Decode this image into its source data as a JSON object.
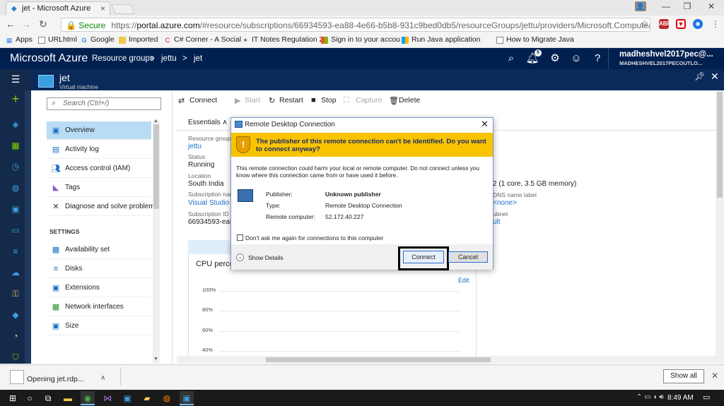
{
  "browser": {
    "tab_title": "jet - Microsoft Azure",
    "tab_close": "×",
    "window_controls": {
      "minimize": "—",
      "restore": "❐",
      "close": "✕"
    },
    "secure_label": "Secure",
    "url_scheme": "https://",
    "url_host": "portal.azure.com",
    "url_path": "/#resource/subscriptions/66934593-ea88-4e66-b5b8-931c9bed0db5/resourceGroups/jettu/providers/Microsoft.Compute/virtualMachines/jet/",
    "bookmarks": [
      {
        "label": "Apps",
        "icon": "apps-grid-icon"
      },
      {
        "label": "URLhtml",
        "icon": "page-icon"
      },
      {
        "label": "Google",
        "icon": "google-icon"
      },
      {
        "label": "Imported",
        "icon": "folder-icon"
      },
      {
        "label": "C# Corner - A Social",
        "icon": "csharp-icon"
      },
      {
        "label": "IT Notes Regulation 2",
        "icon": "it-notes-icon"
      },
      {
        "label": "Sign in to your accou",
        "icon": "microsoft-icon"
      },
      {
        "label": "Run Java application",
        "icon": "microsoft-icon"
      },
      {
        "label": "How to Migrate Java",
        "icon": "page-icon"
      }
    ]
  },
  "azure": {
    "logo": "Microsoft Azure",
    "breadcrumb": [
      "Resource groups",
      "jettu",
      "jet"
    ],
    "breadcrumb_sep": ">",
    "notification_count": "5",
    "user_name": "madheshvel2017pec@...",
    "user_tenant": "MADHESHVEL2017PECOUTLO..."
  },
  "blade": {
    "name": "jet",
    "subtitle": "Virtual machine"
  },
  "menu": {
    "search_placeholder": "Search (Ctrl+/)",
    "items": [
      {
        "label": "Overview",
        "icon": "overview-icon",
        "active": true
      },
      {
        "label": "Activity log",
        "icon": "activity-log-icon"
      },
      {
        "label": "Access control (IAM)",
        "icon": "iam-icon"
      },
      {
        "label": "Tags",
        "icon": "tag-icon"
      },
      {
        "label": "Diagnose and solve problems",
        "icon": "wrench-icon"
      }
    ],
    "settings_header": "SETTINGS",
    "settings_items": [
      {
        "label": "Availability set",
        "icon": "availability-set-icon"
      },
      {
        "label": "Disks",
        "icon": "disk-icon"
      },
      {
        "label": "Extensions",
        "icon": "extension-icon"
      },
      {
        "label": "Network interfaces",
        "icon": "network-icon"
      },
      {
        "label": "Size",
        "icon": "size-icon"
      }
    ]
  },
  "toolbar": {
    "connect": "Connect",
    "start": "Start",
    "restart": "Restart",
    "stop": "Stop",
    "capture": "Capture",
    "delete": "Delete"
  },
  "essentials": {
    "title": "Essentials",
    "resource_group_label": "Resource group",
    "resource_group": "jettu",
    "status_label": "Status",
    "status": "Running",
    "location_label": "Location",
    "location": "South India",
    "subscription_label": "Subscription nar",
    "subscription": "Visual Studio",
    "subscription_id_label": "Subscription ID",
    "subscription_id": "66934593-ea8",
    "size_partial": "2 (1 core, 3.5 GB memory)",
    "dns_label_partial": "DNS name label",
    "dns_value_partial": "<none>",
    "subnet_label_partial": "ubnet",
    "subnet_value_partial": "ult"
  },
  "chart": {
    "title": "CPU perce",
    "edit": "Edit",
    "ticks": [
      "100%",
      "80%",
      "60%",
      "40%"
    ]
  },
  "dialog": {
    "title": "Remote Desktop Connection",
    "close": "✕",
    "warning": "The publisher of this remote connection can't be identified. Do you want to connect anyway?",
    "description": "This remote connection could harm your local or remote computer. Do not connect unless you know where this connection came from or have used it before.",
    "publisher_label": "Publisher:",
    "publisher": "Unknown publisher",
    "type_label": "Type:",
    "type": "Remote Desktop Connection",
    "remote_label": "Remote computer:",
    "remote": "52.172.40.227",
    "checkbox_label": "Don't ask me again for connections to this computer",
    "show_details": "Show Details",
    "connect": "Connect",
    "cancel": "Cancel"
  },
  "download": {
    "file": "Opening jet.rdp...",
    "show_all": "Show all",
    "close": "✕"
  },
  "taskbar": {
    "clock": "8:49 AM"
  }
}
